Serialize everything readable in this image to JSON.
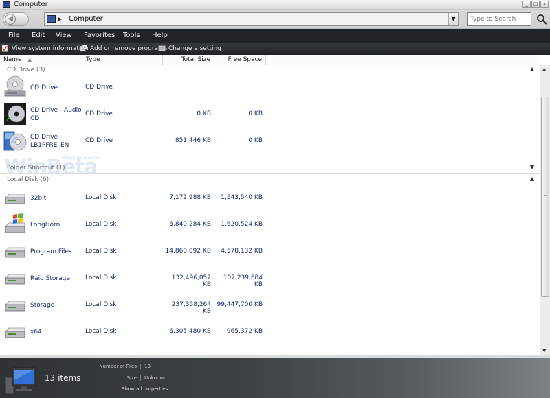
{
  "window": {
    "title": "Computer",
    "controls": [
      "_",
      "□",
      "×"
    ]
  },
  "address": {
    "location": "Computer",
    "search_placeholder": "Type to Search"
  },
  "menu": [
    {
      "label": "File"
    },
    {
      "label": "Edit"
    },
    {
      "label": "View"
    },
    {
      "label": "Favorites"
    },
    {
      "label": "Tools"
    },
    {
      "label": "Help"
    }
  ],
  "tasks": [
    {
      "label": "View system information",
      "icon": "system-info-icon"
    },
    {
      "label": "Add or remove programs",
      "icon": "programs-icon"
    },
    {
      "label": "Change a setting",
      "icon": "settings-icon"
    }
  ],
  "columns": {
    "name": "Name",
    "type": "Type",
    "total": "Total Size",
    "free": "Free Space"
  },
  "groups": {
    "cd": {
      "label": "CD Drive (3)"
    },
    "shortcut": {
      "label": "Folder Shortcut (1)"
    },
    "local": {
      "label": "Local Disk (6)"
    }
  },
  "cd_rows": [
    {
      "name": "CD Drive",
      "type": "CD Drive",
      "total": "",
      "free": "",
      "icon": "cd-drive-icon"
    },
    {
      "name": "CD Drive - Audio CD",
      "type": "CD Drive",
      "total": "0 KB",
      "free": "0 KB",
      "icon": "audio-cd-icon"
    },
    {
      "name": "CD Drive - LB1PFRE_EN",
      "type": "CD Drive",
      "total": "851,446 KB",
      "free": "0 KB",
      "icon": "setup-cd-icon"
    }
  ],
  "disk_rows": [
    {
      "name": "32bit",
      "type": "Local Disk",
      "total": "7,172,988 KB",
      "free": "1,543,540 KB",
      "icon": "hard-disk-icon"
    },
    {
      "name": "LongHorn",
      "type": "Local Disk",
      "total": "6,840,284 KB",
      "free": "1,620,524 KB",
      "icon": "windows-disk-icon"
    },
    {
      "name": "Program Files",
      "type": "Local Disk",
      "total": "14,860,092 KB",
      "free": "4,578,132 KB",
      "icon": "hard-disk-icon"
    },
    {
      "name": "Raid Storage",
      "type": "Local Disk",
      "total": "132,496,052 KB",
      "free": "107,239,684 KB",
      "icon": "hard-disk-icon"
    },
    {
      "name": "Storage",
      "type": "Local Disk",
      "total": "237,358,264 KB",
      "free": "99,447,700 KB",
      "icon": "hard-disk-icon"
    },
    {
      "name": "x64",
      "type": "Local Disk",
      "total": "6,305,480 KB",
      "free": "965,372 KB",
      "icon": "hard-disk-icon"
    }
  ],
  "watermark": {
    "text": "WinBeta",
    "sub": "Beta/news/reviews"
  },
  "details": {
    "count": "13 items",
    "props": [
      {
        "label": "Number of Files",
        "value": "13"
      },
      {
        "label": "Size",
        "value": "Unknown"
      }
    ],
    "show_all": "Show all properties..."
  }
}
